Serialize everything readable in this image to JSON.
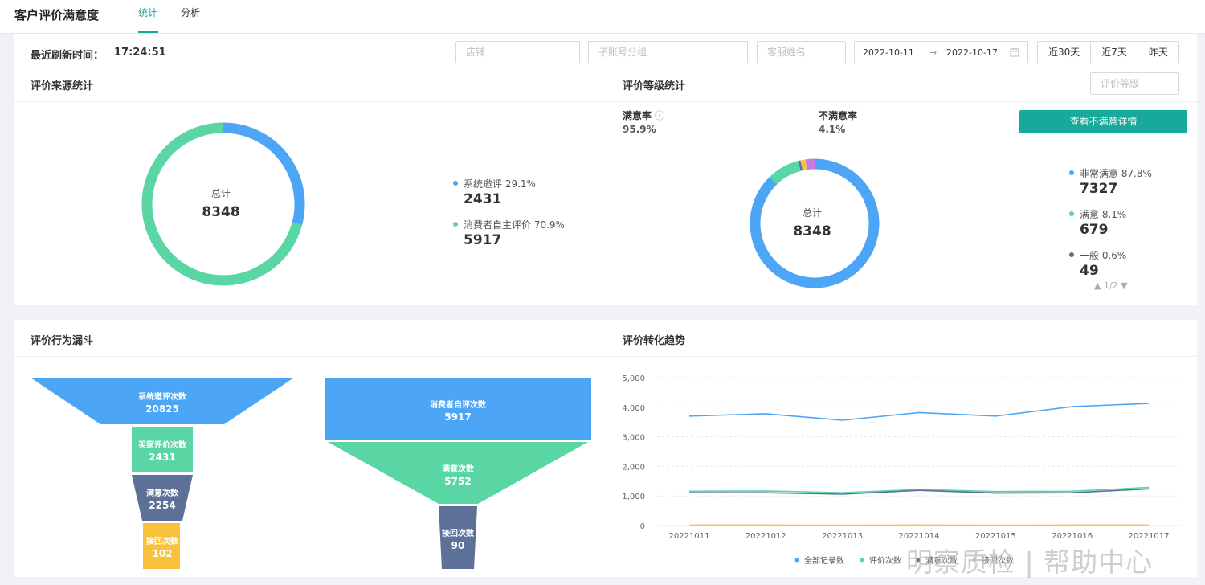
{
  "header": {
    "title": "客户评价满意度",
    "tabs": [
      {
        "label": "统计"
      },
      {
        "label": "分析"
      }
    ]
  },
  "filters": {
    "refresh_label": "最近刷新时间：",
    "refresh_time": "17:24:51",
    "shop_placeholder": "店铺",
    "subaccount_placeholder": "子账号分组",
    "agent_placeholder": "客服姓名",
    "date_start": "2022-10-11",
    "date_arrow": "→",
    "date_end": "2022-10-17",
    "quick_ranges": [
      "近30天",
      "近7天",
      "昨天"
    ]
  },
  "source_stats": {
    "title": "评价来源统计",
    "center_label": "总计",
    "center_value": "8348",
    "items": [
      {
        "label": "系统邀评 29.1%",
        "value": "2431",
        "color": "#4da6f5"
      },
      {
        "label": "消费者自主评价 70.9%",
        "value": "5917",
        "color": "#5ad6a4"
      }
    ]
  },
  "grade_stats": {
    "title": "评价等级统计",
    "grade_placeholder": "评价等级",
    "satisfied_rate_label": "满意率",
    "info_icon": "ⓘ",
    "satisfied_rate": "95.9%",
    "unsatisfied_rate_label": "不满意率",
    "unsatisfied_rate": "4.1%",
    "detail_button": "查看不满意详情",
    "center_label": "总计",
    "center_value": "8348",
    "items": [
      {
        "label": "非常满意 87.8%",
        "value": "7327",
        "color": "#4da6f5"
      },
      {
        "label": "满意 8.1%",
        "value": "679",
        "color": "#5ad6a4"
      },
      {
        "label": "一般 0.6%",
        "value": "49",
        "color": "#5d7097"
      }
    ],
    "pager": "▲ 1/2 ▼"
  },
  "funnel": {
    "title": "评价行为漏斗",
    "left": [
      {
        "label": "系统邀评次数",
        "value": "20825",
        "color": "#4da6f5"
      },
      {
        "label": "买家评价次数",
        "value": "2431",
        "color": "#5ad6a4"
      },
      {
        "label": "满意次数",
        "value": "2254",
        "color": "#5d7097"
      },
      {
        "label": "接回次数",
        "value": "102",
        "color": "#f9c23c"
      }
    ],
    "right": [
      {
        "label": "消费者自评次数",
        "value": "5917",
        "color": "#4da6f5"
      },
      {
        "label": "满意次数",
        "value": "5752",
        "color": "#5ad6a4"
      },
      {
        "label": "接回次数",
        "value": "90",
        "color": "#5d7097"
      }
    ]
  },
  "trend": {
    "title": "评价转化趋势"
  },
  "chart_data": {
    "type": "line",
    "x": [
      "20221011",
      "20221012",
      "20221013",
      "20221014",
      "20221015",
      "20221016",
      "20221017"
    ],
    "yticks": [
      "5,000",
      "4,000",
      "3,000",
      "2,000",
      "1,000",
      "0"
    ],
    "ylim": [
      0,
      5000
    ],
    "grid": true,
    "legend_position": "bottom-right",
    "series": [
      {
        "name": "全部记录数",
        "color": "#4da6f5",
        "values": [
          3700,
          3780,
          3560,
          3820,
          3700,
          4020,
          4130
        ]
      },
      {
        "name": "评价次数",
        "color": "#5ad6a4",
        "values": [
          1160,
          1170,
          1110,
          1220,
          1150,
          1160,
          1290
        ]
      },
      {
        "name": "满意次数",
        "color": "#5d7097",
        "values": [
          1110,
          1110,
          1060,
          1190,
          1100,
          1110,
          1240
        ]
      },
      {
        "name": "接回次数",
        "color": "#f9c23c",
        "values": [
          15,
          14,
          12,
          16,
          13,
          15,
          14
        ]
      }
    ]
  },
  "watermark": "明察质检 | 帮助中心"
}
